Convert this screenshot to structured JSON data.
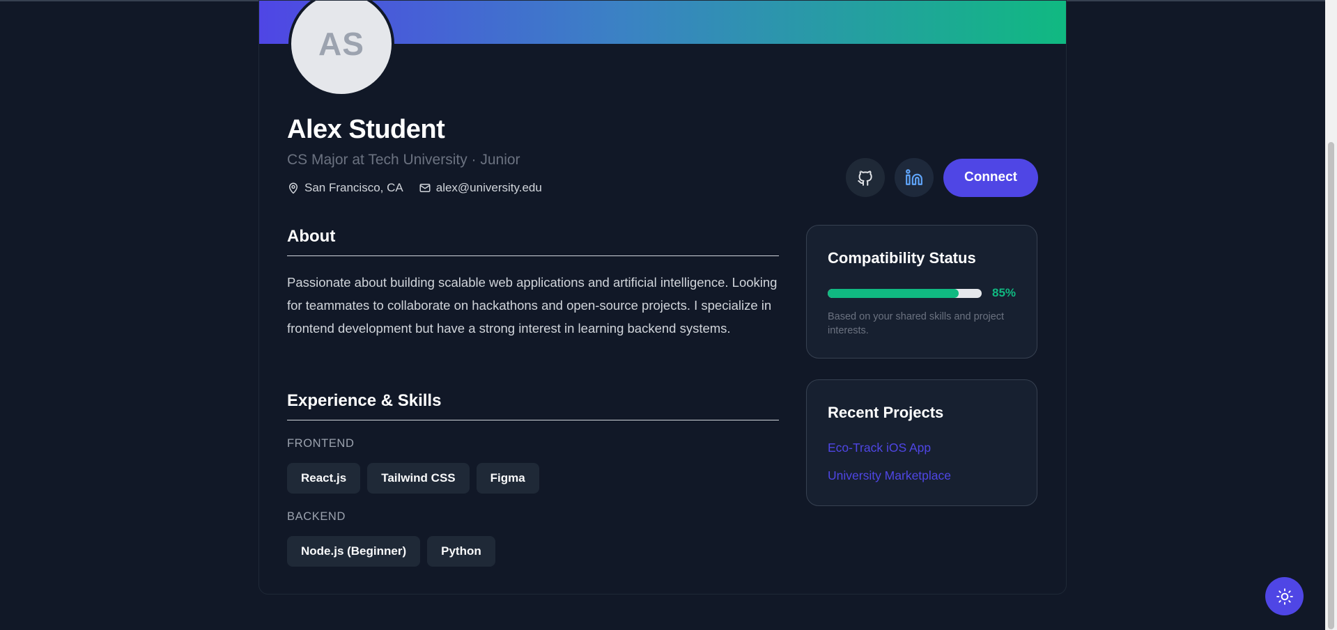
{
  "profile": {
    "initials": "AS",
    "name": "Alex Student",
    "subtitle": "CS Major at Tech University · Junior",
    "location": "San Francisco, CA",
    "email": "alex@university.edu"
  },
  "actions": {
    "connect_label": "Connect",
    "github_icon": "github-icon",
    "linkedin_icon": "linkedin-icon"
  },
  "about": {
    "title": "About",
    "text": "Passionate about building scalable web applications and artificial intelligence. Looking for teammates to collaborate on hackathons and open-source projects. I specialize in frontend development but have a strong interest in learning backend systems."
  },
  "skills": {
    "title": "Experience & Skills",
    "groups": [
      {
        "label": "FRONTEND",
        "items": [
          "React.js",
          "Tailwind CSS",
          "Figma"
        ]
      },
      {
        "label": "BACKEND",
        "items": [
          "Node.js (Beginner)",
          "Python"
        ]
      }
    ]
  },
  "compatibility": {
    "title": "Compatibility Status",
    "percent": 85,
    "value_label": "85%",
    "note": "Based on your shared skills and project interests."
  },
  "projects": {
    "title": "Recent Projects",
    "items": [
      "Eco-Track iOS App",
      "University Marketplace"
    ]
  },
  "colors": {
    "accent": "#4f46e5",
    "success": "#10b981",
    "background": "#111827"
  }
}
